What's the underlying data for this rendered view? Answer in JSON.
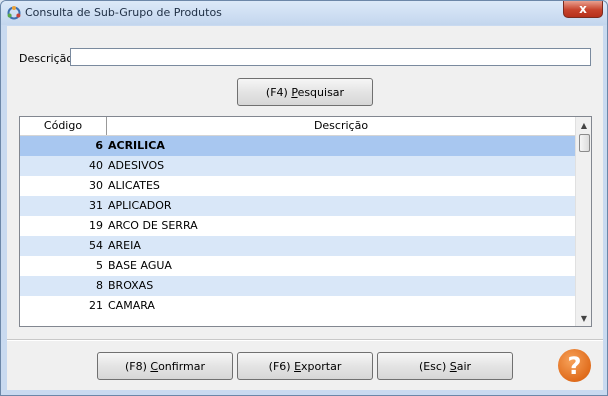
{
  "window": {
    "title": "Consulta de Sub-Grupo de Produtos",
    "close_glyph": "x"
  },
  "search": {
    "label": "Descrição:",
    "value": "",
    "button_prefix": "(F4) ",
    "button_key": "P",
    "button_rest": "esquisar"
  },
  "table": {
    "columns": [
      "Código",
      "Descrição"
    ],
    "selected_index": 0,
    "rows": [
      {
        "code": "6",
        "desc": "ACRILICA"
      },
      {
        "code": "40",
        "desc": "ADESIVOS"
      },
      {
        "code": "30",
        "desc": "ALICATES"
      },
      {
        "code": "31",
        "desc": "APLICADOR"
      },
      {
        "code": "19",
        "desc": "ARCO DE SERRA"
      },
      {
        "code": "54",
        "desc": "AREIA"
      },
      {
        "code": "5",
        "desc": "BASE AGUA"
      },
      {
        "code": "8",
        "desc": "BROXAS"
      },
      {
        "code": "21",
        "desc": "CAMARA"
      }
    ]
  },
  "footer": {
    "confirm_prefix": "(F8) ",
    "confirm_key": "C",
    "confirm_rest": "onfirmar",
    "export_prefix": "(F6) ",
    "export_key": "E",
    "export_rest": "xportar",
    "exit_prefix": "(Esc) ",
    "exit_key": "S",
    "exit_rest": "air",
    "help_glyph": "?"
  },
  "colors": {
    "selected_row": "#a8c7f0",
    "alt_row": "#d9e7f8",
    "help_icon": "#e06c1c"
  }
}
